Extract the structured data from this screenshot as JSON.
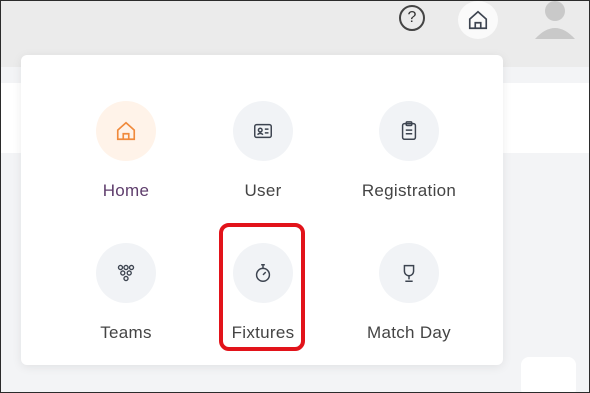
{
  "header": {
    "help_glyph": "?",
    "help_icon": "help-circle-icon",
    "home_icon": "home-icon",
    "avatar_icon": "user-avatar-icon"
  },
  "menu": {
    "items": [
      {
        "label": "Home",
        "icon": "home-icon",
        "active": true
      },
      {
        "label": "User",
        "icon": "id-card-icon",
        "active": false
      },
      {
        "label": "Registration",
        "icon": "clipboard-icon",
        "active": false
      },
      {
        "label": "Teams",
        "icon": "team-icon",
        "active": false
      },
      {
        "label": "Fixtures",
        "icon": "stopwatch-icon",
        "active": false,
        "highlighted": true
      },
      {
        "label": "Match Day",
        "icon": "trophy-icon",
        "active": false
      }
    ]
  },
  "colors": {
    "active_icon": "#f08a3c",
    "active_label": "#5e3d6c",
    "highlight_border": "#e2131a",
    "icon_stroke": "#3d4450"
  }
}
